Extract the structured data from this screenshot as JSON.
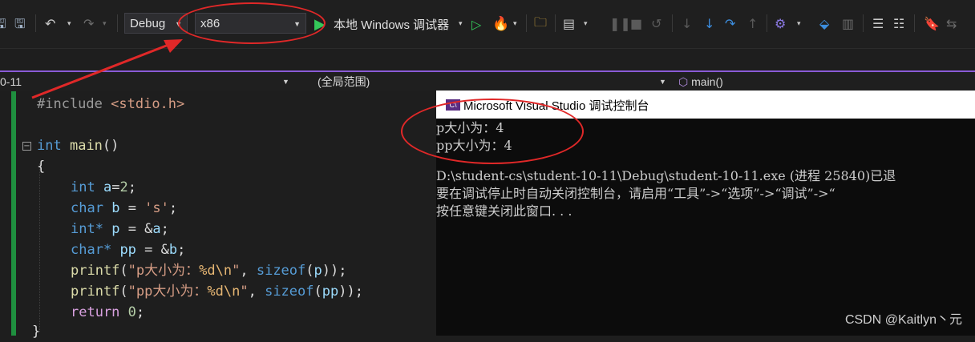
{
  "toolbar": {
    "config": "Debug",
    "platform": "x86",
    "run_target": "本地 Windows 调试器"
  },
  "navbar": {
    "project": "0-11",
    "scope": "(全局范围)",
    "function": "main()"
  },
  "code": {
    "line1_directive": "#include",
    "line1_header": "<stdio.h>",
    "line2_type": "int",
    "line2_name": "main",
    "line2_parens": "()",
    "brace_open": "{",
    "line3_type": "int",
    "line3_var": "a",
    "line3_val": "2",
    "line4_type": "char",
    "line4_var": "b",
    "line4_val": "'s'",
    "line5_type": "int*",
    "line5_var": "p",
    "line5_ref": "a",
    "line6_type": "char*",
    "line6_var": "pp",
    "line6_ref": "b",
    "printf": "printf",
    "line7_str": "\"p大小为：",
    "line7_fmt": "%d\\n",
    "line7_arg": "p",
    "line8_str": "\"pp大小为：",
    "line8_fmt": "%d\\n",
    "line8_arg": "pp",
    "sizeof": "sizeof",
    "return_kw": "return",
    "return_val": "0"
  },
  "console": {
    "title": "Microsoft Visual Studio 调试控制台",
    "icon_label": "C\\",
    "lines": [
      "p大小为：4",
      "pp大小为：4",
      "",
      "D:\\student-cs\\student-10-11\\Debug\\student-10-11.exe (进程 25840)已退",
      "要在调试停止时自动关闭控制台，请启用“工具”->“选项”->“调试”->“",
      "按任意键关闭此窗口. . ."
    ]
  },
  "watermark": "CSDN @Kaitlyn丶元",
  "colors": {
    "annotation": "#e02828",
    "accent_purple": "#8a5bd6",
    "play_green": "#34c759"
  },
  "icons": [
    "save-icon",
    "save-all-icon",
    "undo-icon",
    "redo-icon",
    "start-icon",
    "start-without-debug-icon",
    "hot-reload-icon",
    "open-folder-icon",
    "layout-icon",
    "pause-icon",
    "stop-icon",
    "restart-icon",
    "step-over-icon",
    "step-into-icon",
    "step-out-icon",
    "bookmark-icon"
  ]
}
